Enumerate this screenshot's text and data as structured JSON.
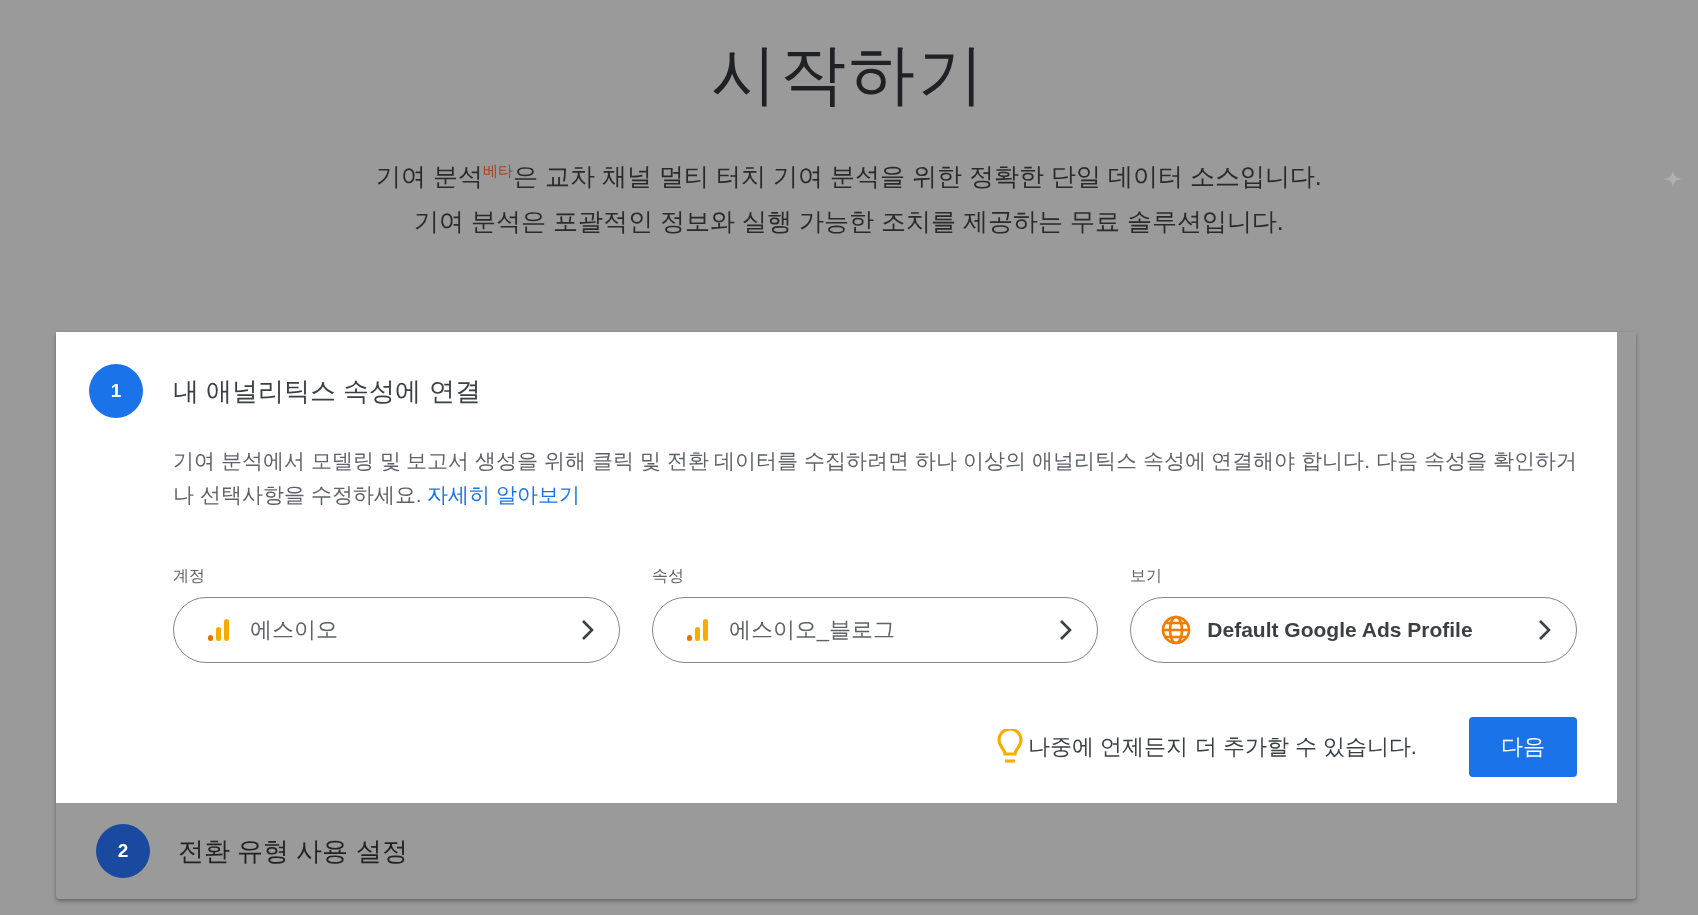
{
  "header": {
    "title": "시작하기",
    "subtitle_lines": [
      "기여 분석$^{베타}$은 교차 채널 멀티 터치 기여 분석을 위한 정확한 단일 데이터 소스입니다.",
      "기여 분석은 포괄적인 정보와 실행 가능한 조치를 제공하는 무료 솔루션입니다."
    ]
  },
  "steps": [
    {
      "number": "1",
      "title": "내 애널리틱스 속성에 연결",
      "active": true,
      "description": "기여 분석에서 모델링 및 보고서 생성을 위해 클릭 및 전환 데이터를 수집하려면 하나 이상의 애널리틱스 속성에 연결해야 합니다. 다음 속성을 확인하거나 선택사항을 수정하세요.",
      "link": "자세히 알아보기",
      "fields": [
        {
          "label": "계정",
          "value": "에스이오",
          "kind": "analytics"
        },
        {
          "label": "속성",
          "value": "에스이오_블로그",
          "kind": "analytics"
        },
        {
          "label": "보기",
          "value": "Default Google Ads Profile",
          "kind": "globe"
        }
      ],
      "hint": "나중에 언제든지 더 추가할 수 있습니다.",
      "button": "다음"
    },
    {
      "number": "2",
      "title": "전환 유형 사용 설정",
      "active": false
    }
  ]
}
